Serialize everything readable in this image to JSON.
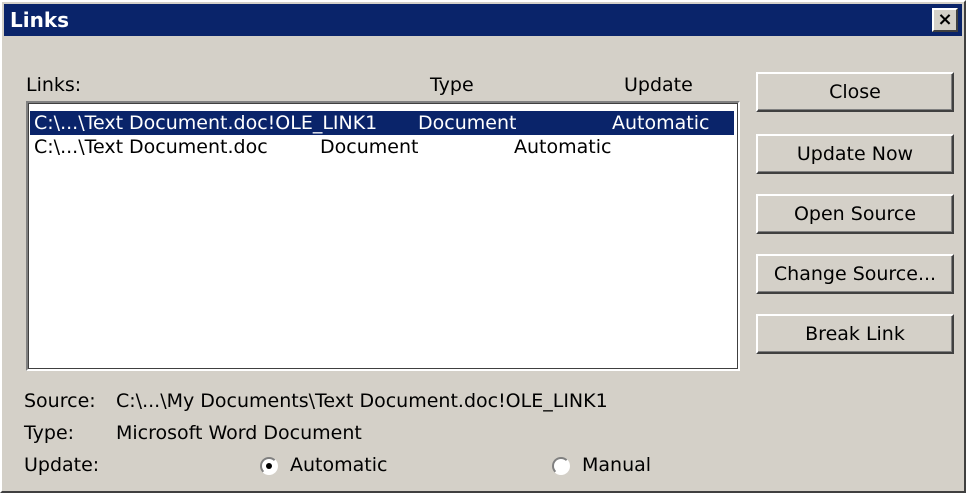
{
  "window": {
    "title": "Links",
    "close_glyph": "×"
  },
  "list": {
    "header": {
      "links": "Links:",
      "type": "Type",
      "update": "Update"
    },
    "rows": [
      {
        "name": "C:\\...\\Text Document.doc!OLE_LINK1",
        "type": "Document",
        "update": "Automatic",
        "selected": true
      },
      {
        "name": "C:\\...\\Text Document.doc",
        "type": "Document",
        "update": "Automatic",
        "selected": false
      }
    ]
  },
  "buttons": {
    "close": "Close",
    "update_now": "Update Now",
    "open_source": "Open Source",
    "change_source": "Change Source...",
    "break_link": "Break Link"
  },
  "details": {
    "source_label": "Source:",
    "source_value": "C:\\...\\My Documents\\Text Document.doc!OLE_LINK1",
    "type_label": "Type:",
    "type_value": "Microsoft Word Document",
    "update_label": "Update:",
    "automatic_label": "Automatic",
    "manual_label": "Manual",
    "selected_update": "Automatic"
  },
  "colors": {
    "titlebar": "#0a246a",
    "selection": "#0a246a",
    "face": "#d4d0c8"
  }
}
